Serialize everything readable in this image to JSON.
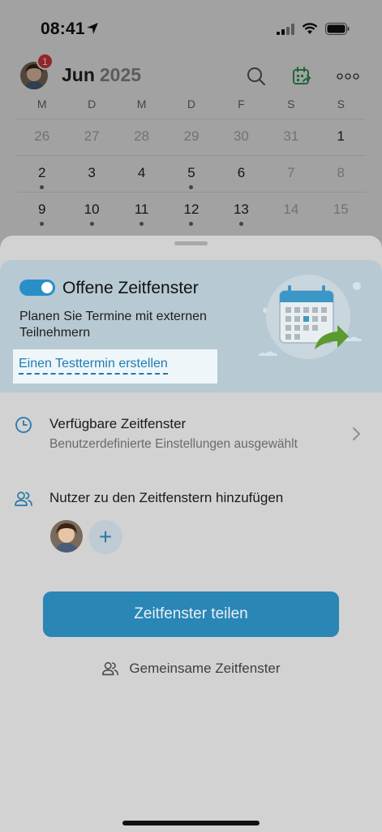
{
  "status_bar": {
    "time": "08:41"
  },
  "calendar": {
    "month": "Jun",
    "year": "2025",
    "notification_badge": "1",
    "weekdays": [
      "M",
      "D",
      "M",
      "D",
      "F",
      "S",
      "S"
    ],
    "weeks": [
      [
        "26",
        "27",
        "28",
        "29",
        "30",
        "31",
        "1"
      ],
      [
        "2",
        "3",
        "4",
        "5",
        "6",
        "7",
        "8"
      ],
      [
        "9",
        "10",
        "11",
        "12",
        "13",
        "14",
        "15"
      ]
    ]
  },
  "sheet": {
    "promo": {
      "toggle_on": true,
      "title": "Offene Zeitfenster",
      "description": "Planen Sie Termine mit externen Teilnehmern",
      "test_link": "Einen Testtermin erstellen"
    },
    "available_slots": {
      "title": "Verfügbare Zeitfenster",
      "subtitle": "Benutzerdefinierte Einstellungen ausgewählt"
    },
    "add_users": {
      "title": "Nutzer zu den Zeitfenstern hinzufügen",
      "add_symbol": "+"
    },
    "share_button": "Zeitfenster teilen",
    "shared_slots_link": "Gemeinsame Zeitfenster"
  },
  "colors": {
    "accent": "#2a86b5",
    "badge": "#d93a3a",
    "promo_bg": "#b7c9d2",
    "link": "#1f7cb0"
  }
}
